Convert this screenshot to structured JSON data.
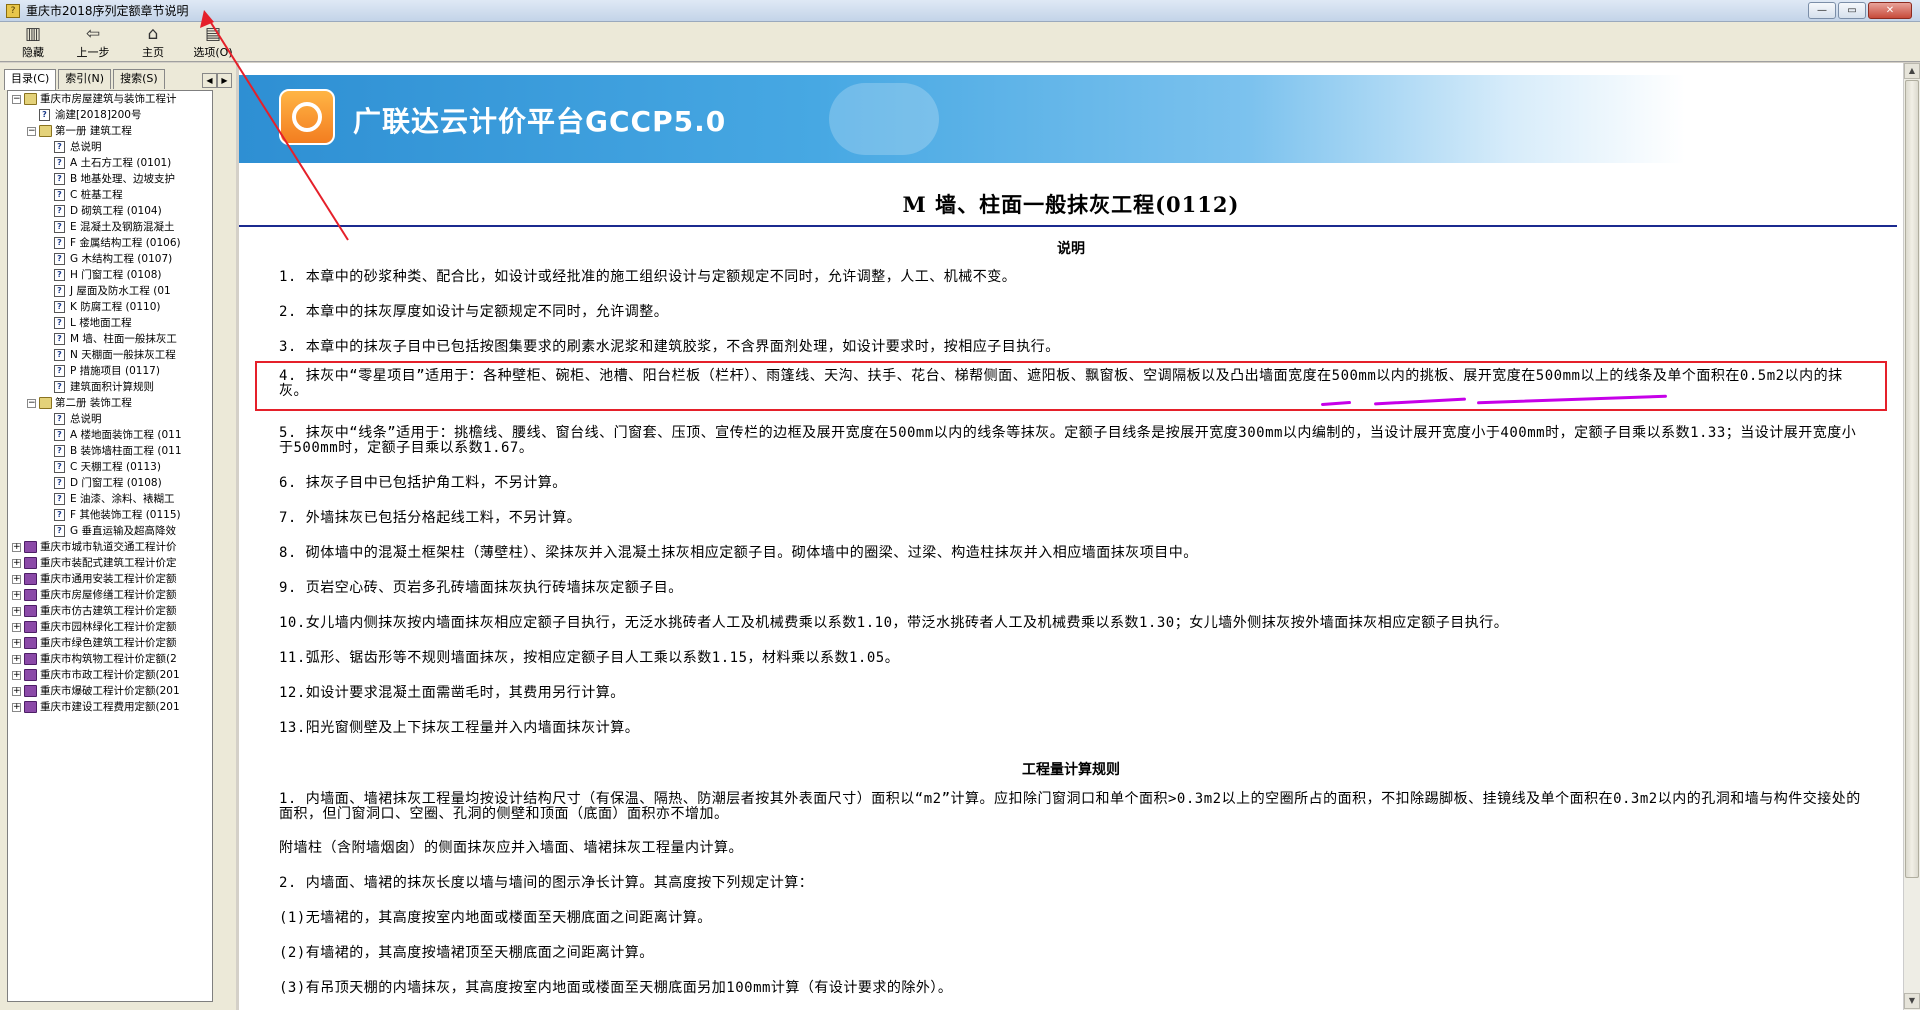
{
  "window": {
    "title": "重庆市2018序列定额章节说明",
    "controls": [
      "—",
      "▭",
      "✕"
    ]
  },
  "toolbar": {
    "buttons": [
      {
        "label": "隐藏",
        "icon": "hide-icon"
      },
      {
        "label": "上一步",
        "icon": "back-arrow-icon"
      },
      {
        "label": "主页",
        "icon": "home-icon"
      },
      {
        "label": "选项(O)",
        "icon": "options-icon"
      }
    ]
  },
  "tabs": [
    {
      "label": "目录(C)"
    },
    {
      "label": "索引(N)"
    },
    {
      "label": "搜索(S)"
    }
  ],
  "tree": {
    "root": "重庆市房屋建筑与装饰工程计",
    "root_child": "渝建[2018]200号",
    "book1": "第一册 建筑工程",
    "book1_items": [
      "总说明",
      "A 土石方工程 (0101)",
      "B 地基处理、边坡支护",
      "C 桩基工程",
      "D 砌筑工程 (0104)",
      "E 混凝土及钢筋混凝土",
      "F 金属结构工程 (0106)",
      "G 木结构工程 (0107)",
      "H 门窗工程 (0108)",
      "J 屋面及防水工程 (01",
      "K 防腐工程 (0110)",
      "L 楼地面工程",
      "M 墙、柱面一般抹灰工",
      "N 天棚面一般抹灰工程",
      "P 措施项目 (0117)",
      "建筑面积计算规则"
    ],
    "book2": "第二册 装饰工程",
    "book2_items": [
      "总说明",
      "A 楼地面装饰工程 (011",
      "B 装饰墙柱面工程 (011",
      "C 天棚工程 (0113)",
      "D 门窗工程 (0108)",
      "E 油漆、涂料、裱糊工",
      "F 其他装饰工程 (0115)",
      "G 垂直运输及超高降效"
    ],
    "others": [
      "重庆市城市轨道交通工程计价",
      "重庆市装配式建筑工程计价定",
      "重庆市通用安装工程计价定额",
      "重庆市房屋修缮工程计价定额",
      "重庆市仿古建筑工程计价定额",
      "重庆市园林绿化工程计价定额",
      "重庆市绿色建筑工程计价定额",
      "重庆市构筑物工程计价定额(2",
      "重庆市市政工程计价定额(201",
      "重庆市爆破工程计价定额(201",
      "重庆市建设工程费用定额(201"
    ]
  },
  "banner": {
    "brand": "广联达云计价平台GCCP5.0",
    "logo_colors": [
      "#ffb545",
      "#f37d20"
    ]
  },
  "document": {
    "title": "M 墙、柱面一般抹灰工程(0112)",
    "section1": "说明",
    "notes": [
      "1. 本章中的砂浆种类、配合比，如设计或经批准的施工组织设计与定额规定不同时，允许调整，人工、机械不变。",
      "2. 本章中的抹灰厚度如设计与定额规定不同时，允许调整。",
      "3. 本章中的抹灰子目中已包括按图集要求的刷素水泥浆和建筑胶浆，不含界面剂处理，如设计要求时，按相应子目执行。",
      "4. 抹灰中“零星项目”适用于：各种壁柜、碗柜、池槽、阳台栏板（栏杆）、雨篷线、天沟、扶手、花台、梯帮侧面、遮阳板、飘窗板、空调隔板以及凸出墙面宽度在500mm以内的挑板、展开宽度在500mm以上的线条及单个面积在0.5m2以内的抹灰。",
      "5. 抹灰中“线条”适用于：挑檐线、腰线、窗台线、门窗套、压顶、宣传栏的边框及展开宽度在500mm以内的线条等抹灰。定额子目线条是按展开宽度300mm以内编制的，当设计展开宽度小于400mm时，定额子目乘以系数1.33；当设计展开宽度小于500mm时，定额子目乘以系数1.67。",
      "6. 抹灰子目中已包括护角工料，不另计算。",
      "7. 外墙抹灰已包括分格起线工料，不另计算。",
      "8. 砌体墙中的混凝土框架柱（薄壁柱）、梁抹灰并入混凝土抹灰相应定额子目。砌体墙中的圈梁、过梁、构造柱抹灰并入相应墙面抹灰项目中。",
      "9. 页岩空心砖、页岩多孔砖墙面抹灰执行砖墙抹灰定额子目。",
      "10.女儿墙内侧抹灰按内墙面抹灰相应定额子目执行，无泛水挑砖者人工及机械费乘以系数1.10，带泛水挑砖者人工及机械费乘以系数1.30；女儿墙外侧抹灰按外墙面抹灰相应定额子目执行。",
      "11.弧形、锯齿形等不规则墙面抹灰，按相应定额子目人工乘以系数1.15，材料乘以系数1.05。",
      "12.如设计要求混凝土面需凿毛时，其费用另行计算。",
      "13.阳光窗侧壁及上下抹灰工程量并入内墙面抹灰计算。"
    ],
    "section2": "工程量计算规则",
    "rules": [
      "1. 内墙面、墙裙抹灰工程量均按设计结构尺寸（有保温、隔热、防潮层者按其外表面尺寸）面积以“m2”计算。应扣除门窗洞口和单个面积>0.3m2以上的空圈所占的面积，不扣除踢脚板、挂镜线及单个面积在0.3m2以内的孔洞和墙与构件交接处的面积，但门窗洞口、空圈、孔洞的侧壁和顶面（底面）面积亦不增加。",
      "附墙柱（含附墙烟囱）的侧面抹灰应并入墙面、墙裙抹灰工程量内计算。",
      "2. 内墙面、墙裙的抹灰长度以墙与墙间的图示净长计算。其高度按下列规定计算：",
      "(1)无墙裙的，其高度按室内地面或楼面至天棚底面之间距离计算。",
      "(2)有墙裙的，其高度按墙裙顶至天棚底面之间距离计算。",
      "(3)有吊顶天棚的内墙抹灰，其高度按室内地面或楼面至天棚底面另加100mm计算（有设计要求的除外）。"
    ]
  },
  "annotation_colors": {
    "box": "#e5202a",
    "underline": "#c600e8",
    "arrow": "#e5202a"
  }
}
